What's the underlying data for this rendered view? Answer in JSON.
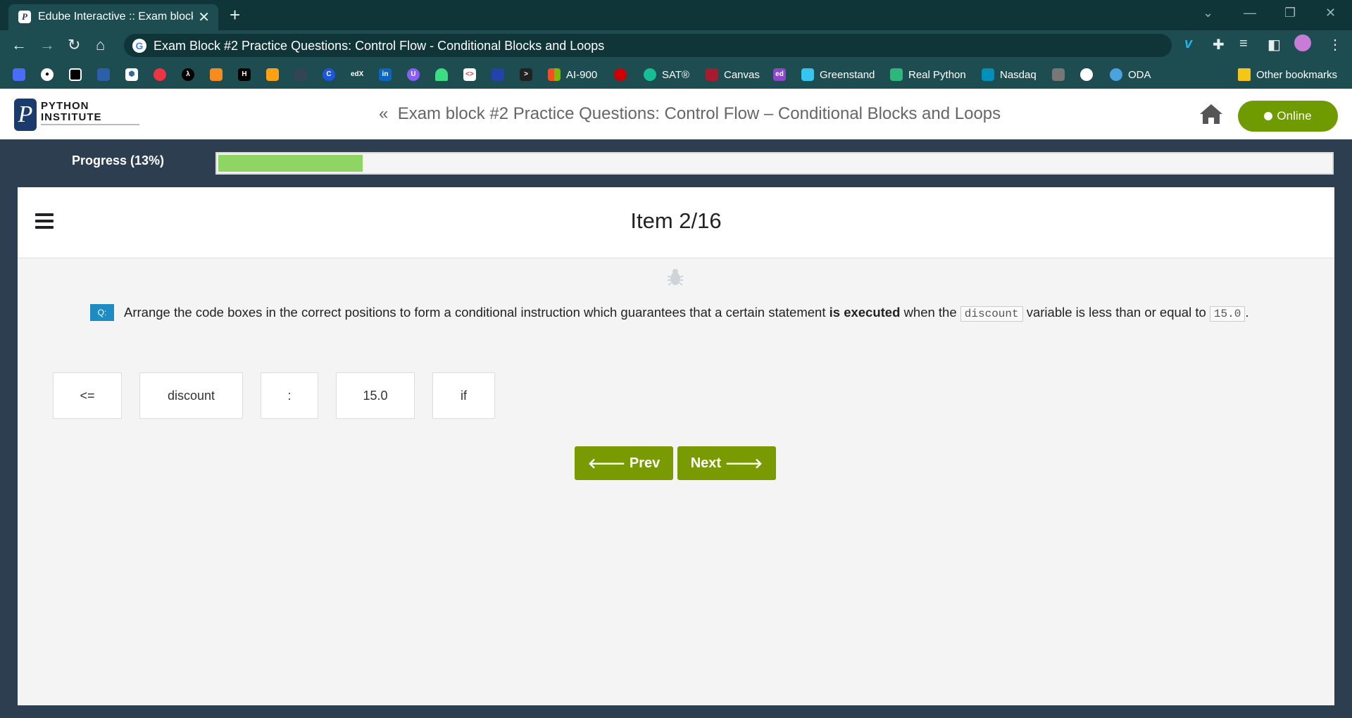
{
  "browser": {
    "tab_title": "Edube Interactive :: Exam block #",
    "tab_icon": "P",
    "url": "Exam Block #2 Practice Questions: Control Flow - Conditional Blocks and Loops",
    "bookmarks": [
      {
        "label": "AI-900",
        "icon": "microsoft-icon",
        "color": "#f25022"
      },
      {
        "label": "SAT®",
        "icon": "khan-icon",
        "color": "#14bf96"
      },
      {
        "label": "Canvas",
        "icon": "harvard-icon",
        "color": "#a51c30"
      },
      {
        "label": "",
        "icon": "ed-icon",
        "color": "#8b49c9"
      },
      {
        "label": "Greenstand",
        "icon": "slack-icon",
        "color": "#36c5f0"
      },
      {
        "label": "Real Python",
        "icon": "slack-icon",
        "color": "#2eb67d"
      },
      {
        "label": "Nasdaq",
        "icon": "nasdaq-icon",
        "color": "#0090ba"
      },
      {
        "label": "ODA",
        "icon": "oda-icon",
        "color": "#4aa3df"
      }
    ],
    "other_bookmarks": "Other bookmarks"
  },
  "header": {
    "logo_line1": "PYTHON",
    "logo_line2": "INSTITUTE",
    "page_title": "Exam block #2 Practice Questions: Control Flow – Conditional Blocks and Loops",
    "back_glyph": "«",
    "status": "Online"
  },
  "progress": {
    "label": "Progress (13%)",
    "fraction": 0.13
  },
  "item": {
    "title": "Item 2/16",
    "badge": "Q:",
    "question_pre": "Arrange the code boxes in the correct positions to form a conditional instruction which guarantees that a certain statement ",
    "question_bold": "is executed",
    "question_mid": " when the ",
    "code1": "discount",
    "question_mid2": " variable is less than or equal to ",
    "code2": "15.0",
    "question_end": "."
  },
  "code_boxes": [
    "<=",
    "discount",
    ":",
    "15.0",
    "if"
  ],
  "nav": {
    "prev": "Prev",
    "next": "Next"
  },
  "colors": {
    "accent_green": "#7a9a01",
    "progress_fill": "#8fd563",
    "badge_blue": "#1e8bc3",
    "bg_dark": "#2c3e50"
  }
}
